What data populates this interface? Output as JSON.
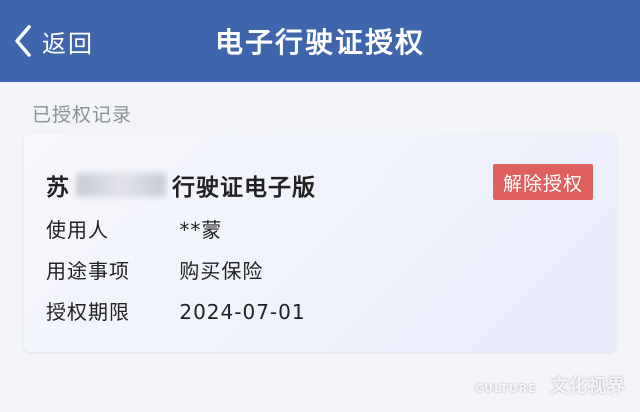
{
  "navbar": {
    "back_label": "返回",
    "title": "电子行驶证授权",
    "background": "#3f65ad"
  },
  "section": {
    "label": "已授权记录"
  },
  "record": {
    "plate_prefix": "苏",
    "title_suffix": "行驶证电子版",
    "revoke_label": "解除授权",
    "revoke_color": "#e06060",
    "fields": [
      {
        "label": "使用人",
        "value": "**蒙"
      },
      {
        "label": "用途事项",
        "value": "购买保险"
      },
      {
        "label": "授权期限",
        "value": "2024-07-01"
      }
    ]
  },
  "watermark": {
    "latin": "CULTURE",
    "text": "文化视界"
  }
}
